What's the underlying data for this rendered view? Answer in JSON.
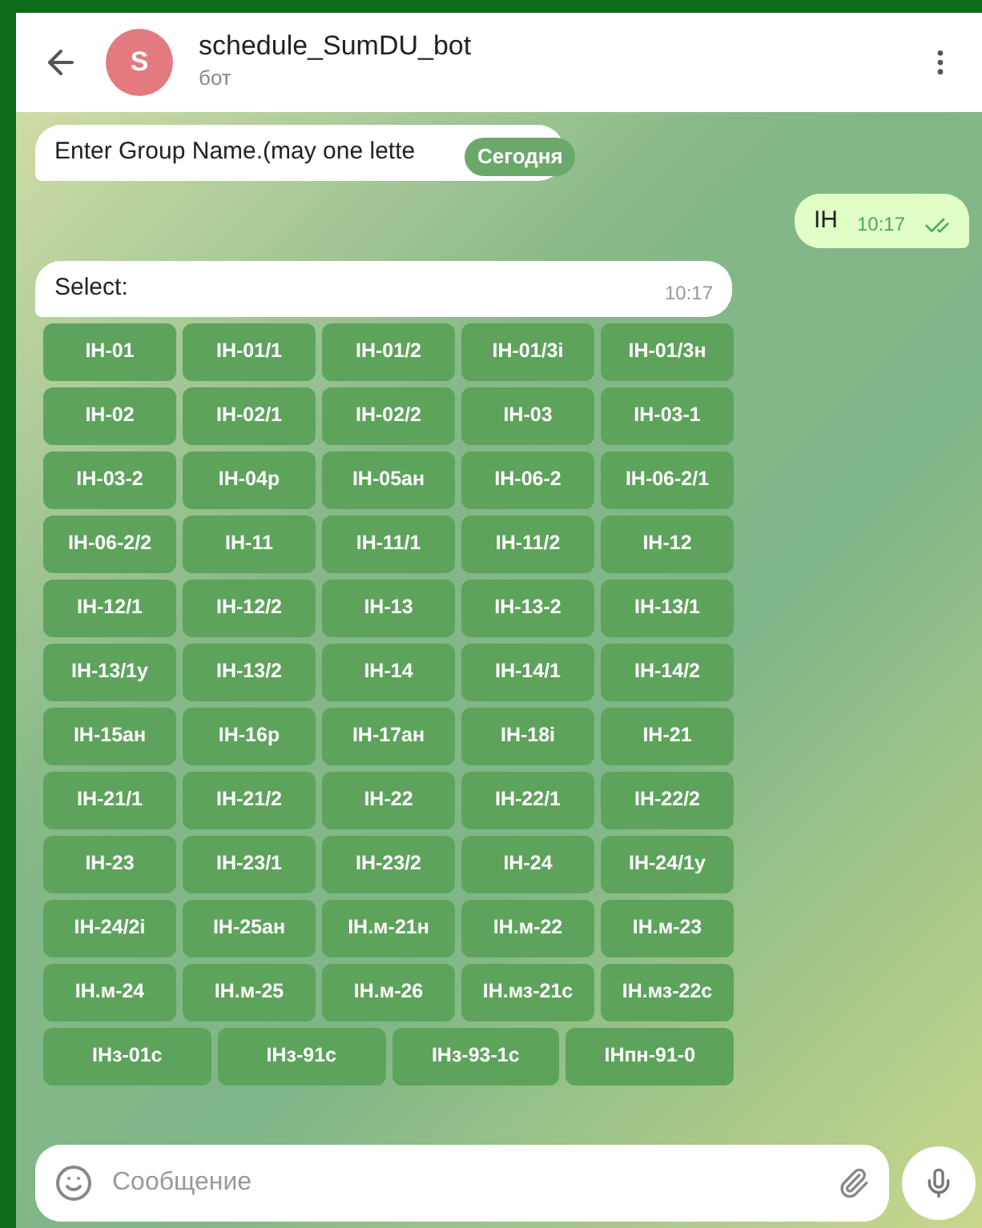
{
  "header": {
    "avatar_letter": "S",
    "title": "schedule_SumDU_bot",
    "subtitle": "бот"
  },
  "date_pill": "Сегодня",
  "messages": [
    {
      "kind": "incoming",
      "text": "Enter Group Name.(may one lette"
    },
    {
      "kind": "outgoing",
      "text": "IH",
      "time": "10:17",
      "read": true
    },
    {
      "kind": "incoming",
      "text": "Select:",
      "time": "10:17"
    }
  ],
  "keyboard": [
    [
      "IH-01",
      "IH-01/1",
      "IH-01/2",
      "IH-01/3i",
      "IH-01/3н"
    ],
    [
      "IH-02",
      "IH-02/1",
      "IH-02/2",
      "IH-03",
      "IH-03-1"
    ],
    [
      "IH-03-2",
      "IH-04p",
      "IH-05ан",
      "IH-06-2",
      "IH-06-2/1"
    ],
    [
      "IH-06-2/2",
      "IH-11",
      "IH-11/1",
      "IH-11/2",
      "IH-12"
    ],
    [
      "IH-12/1",
      "IH-12/2",
      "IH-13",
      "IH-13-2",
      "IH-13/1"
    ],
    [
      "IH-13/1y",
      "IH-13/2",
      "IH-14",
      "IH-14/1",
      "IH-14/2"
    ],
    [
      "IH-15ан",
      "IH-16p",
      "IH-17ан",
      "IH-18i",
      "IH-21"
    ],
    [
      "IH-21/1",
      "IH-21/2",
      "IH-22",
      "IH-22/1",
      "IH-22/2"
    ],
    [
      "IH-23",
      "IH-23/1",
      "IH-23/2",
      "IH-24",
      "IH-24/1y"
    ],
    [
      "IH-24/2i",
      "IH-25ан",
      "IH.м-21н",
      "IH.м-22",
      "IH.м-23"
    ],
    [
      "IH.м-24",
      "IH.м-25",
      "IH.м-26",
      "IH.мз-21с",
      "IH.мз-22с"
    ],
    [
      "IHз-01с",
      "IHз-91с",
      "IHз-93-1с",
      "IHпн-91-0"
    ]
  ],
  "input": {
    "placeholder": "Сообщение"
  }
}
